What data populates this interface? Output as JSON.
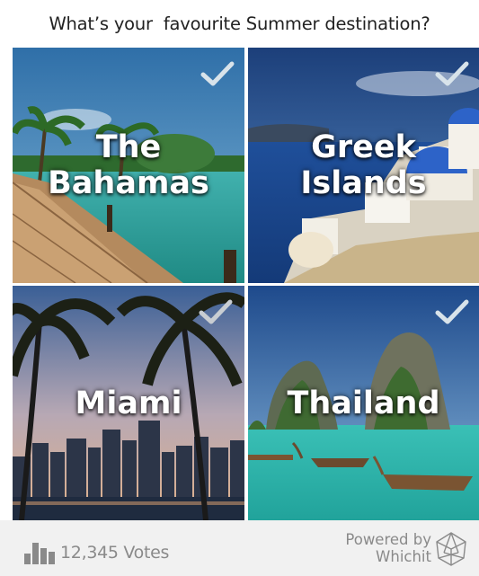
{
  "poll": {
    "question": "What’s your  favourite Summer destination?",
    "options": [
      {
        "label": "The\nBahamas",
        "icon": "check-icon"
      },
      {
        "label": "Greek\nIslands",
        "icon": "check-icon"
      },
      {
        "label": "Miami",
        "icon": "check-icon"
      },
      {
        "label": "Thailand",
        "icon": "check-icon"
      }
    ]
  },
  "footer": {
    "votes": "12,345 Votes",
    "powered_by": "Powered by",
    "brand": "Whichit",
    "votes_icon": "bar-chart-icon",
    "logo_icon": "whichit-logo-icon"
  },
  "colors": {
    "label_text": "#ffffff",
    "check": "#d8e3ea",
    "footer_bg": "#f1f1f1",
    "footer_text": "#8a8a8a",
    "question_text": "#222222"
  }
}
